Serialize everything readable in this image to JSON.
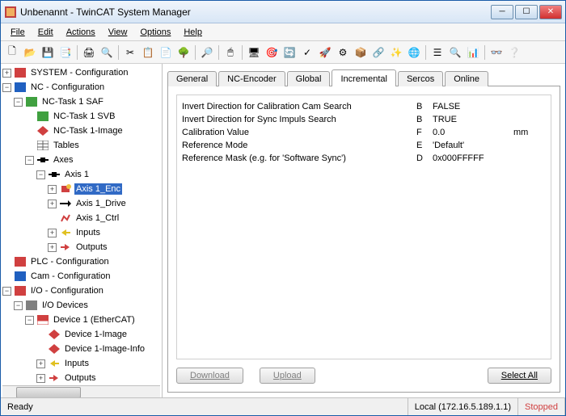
{
  "title": "Unbenannt - TwinCAT System Manager",
  "menu": {
    "file": "File",
    "edit": "Edit",
    "actions": "Actions",
    "view": "View",
    "options": "Options",
    "help": "Help"
  },
  "tree": {
    "system": "SYSTEM - Configuration",
    "nc": "NC - Configuration",
    "nctask": "NC-Task 1 SAF",
    "nctasksvb": "NC-Task 1 SVB",
    "nctaskimg": "NC-Task 1-Image",
    "tables": "Tables",
    "axes": "Axes",
    "axis1": "Axis 1",
    "axis1enc": "Axis 1_Enc",
    "axis1drive": "Axis 1_Drive",
    "axis1ctrl": "Axis 1_Ctrl",
    "inputs": "Inputs",
    "outputs": "Outputs",
    "plc": "PLC - Configuration",
    "cam": "Cam - Configuration",
    "io": "I/O - Configuration",
    "iodev": "I/O Devices",
    "dev1": "Device 1 (EtherCAT)",
    "dev1img": "Device 1-Image",
    "dev1imginfo": "Device 1-Image-Info",
    "inputs2": "Inputs",
    "outputs2": "Outputs"
  },
  "tabs": {
    "general": "General",
    "ncenc": "NC-Encoder",
    "global": "Global",
    "incremental": "Incremental",
    "sercos": "Sercos",
    "online": "Online"
  },
  "params": [
    {
      "name": "Invert Direction for Calibration Cam Search",
      "type": "B",
      "value": "FALSE",
      "unit": ""
    },
    {
      "name": "Invert Direction for Sync Impuls Search",
      "type": "B",
      "value": "TRUE",
      "unit": ""
    },
    {
      "name": "Calibration Value",
      "type": "F",
      "value": "0.0",
      "unit": "mm"
    },
    {
      "name": "Reference Mode",
      "type": "E",
      "value": "'Default'",
      "unit": ""
    },
    {
      "name": "Reference Mask (e.g. for 'Software Sync')",
      "type": "D",
      "value": "0x000FFFFF",
      "unit": ""
    }
  ],
  "buttons": {
    "download": "Download",
    "upload": "Upload",
    "selectall": "Select All"
  },
  "status": {
    "ready": "Ready",
    "local": "Local (172.16.5.189.1.1)",
    "stopped": "Stopped"
  }
}
